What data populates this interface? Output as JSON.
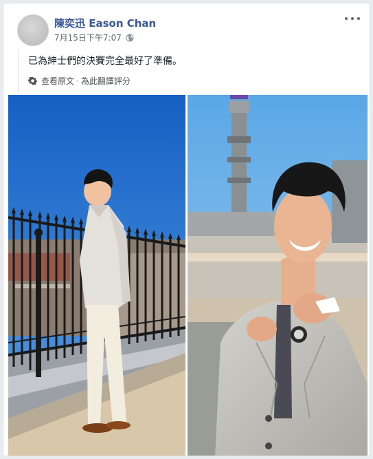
{
  "post": {
    "author": "陳奕迅 Eason Chan",
    "timestamp": "7月15日下午7:07",
    "text": "已為紳士們的決賽完全最好了準備。",
    "see_original": "查看原文",
    "rate_translation": "為此翻譯評分",
    "separator": "·"
  },
  "icons": {
    "privacy": "globe-icon",
    "menu": "more-options-icon",
    "translation": "gear-icon"
  },
  "colors": {
    "author_link": "#385898",
    "meta_text": "#616770",
    "body_text": "#1d2129",
    "background": "#e9ebee"
  }
}
